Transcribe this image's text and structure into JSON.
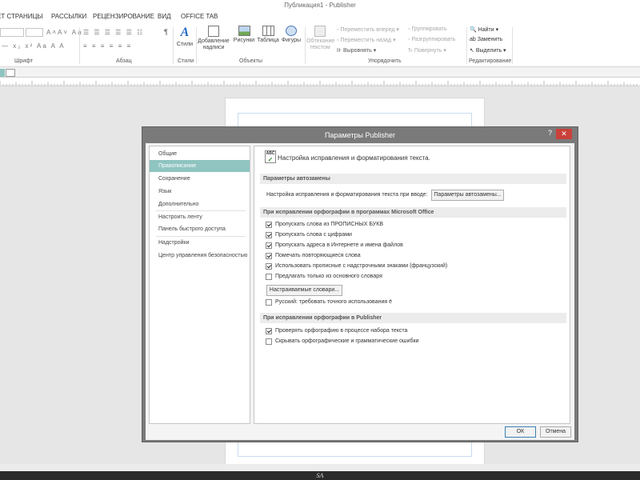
{
  "window": {
    "title": "Публикация1 - Publisher"
  },
  "ribbon": {
    "tabs": [
      "ЕТ СТРАНИЦЫ",
      "РАССЫЛКИ",
      "РЕЦЕНЗИРОВАНИЕ",
      "ВИД",
      "OFFICE TAB"
    ],
    "groups": {
      "font": "Шрифт",
      "paragraph": "Абзац",
      "styles": "Стили",
      "objects": "Объекты",
      "arrange": "Упорядочить",
      "editing": "Редактирование"
    },
    "buttons": {
      "styles": "Стили",
      "add_text": [
        "Добавление",
        "надписи"
      ],
      "pictures": "Рисунки",
      "table": "Таблица",
      "shapes": "Фигуры",
      "wrap_text": [
        "Обтекание",
        "текстом"
      ],
      "bring_forward": "Переместить вперед",
      "send_backward": "Переместить назад",
      "align": "Выровнять",
      "group": "Группировать",
      "ungroup": "Разгруппировать",
      "rotate": "Повернуть",
      "find": "Найти",
      "replace": "Заменить",
      "select": "Выделить"
    }
  },
  "dialog": {
    "title": "Параметры Publisher",
    "help": "?",
    "close": "✕",
    "nav": {
      "general": "Общие",
      "proofing": "Правописание",
      "save": "Сохранение",
      "language": "Язык",
      "advanced": "Дополнительно",
      "customize_ribbon": "Настроить ленту",
      "quick_access": "Панель быстрого доступа",
      "addins": "Надстройки",
      "trust_center": "Центр управления безопасностью"
    },
    "content": {
      "header": "Настройка исправления и форматирования текста.",
      "autocorrect_section": "Параметры автозамены",
      "autocorrect_label": "Настройка исправления и форматирования текста при вводе:",
      "autocorrect_button": "Параметры автозамены...",
      "office_section": "При исправлении орфографии в программах Microsoft Office",
      "office_options": [
        {
          "label": "Пропускать слова из ПРОПИСНЫХ БУКВ",
          "checked": true
        },
        {
          "label": "Пропускать слова с цифрами",
          "checked": true
        },
        {
          "label": "Пропускать адреса в Интернете и имена файлов",
          "checked": true
        },
        {
          "label": "Помечать повторяющиеся слова",
          "checked": true
        },
        {
          "label": "Использовать прописные с надстрочными знаками (французский)",
          "checked": true
        },
        {
          "label": "Предлагать только из основного словаря",
          "checked": false
        }
      ],
      "custom_dict_button": "Настраиваемые словари...",
      "russian_option": {
        "label": "Русский: требовать точного использования ё",
        "checked": false
      },
      "publisher_section": "При исправлении орфографии в Publisher",
      "publisher_options": [
        {
          "label": "Проверять орфографию в процессе набора текста",
          "checked": true
        },
        {
          "label": "Скрывать орфографические и грамматические ошибки",
          "checked": false
        }
      ]
    },
    "ok": "ОК",
    "cancel": "Отмена"
  },
  "watermark": "SA"
}
